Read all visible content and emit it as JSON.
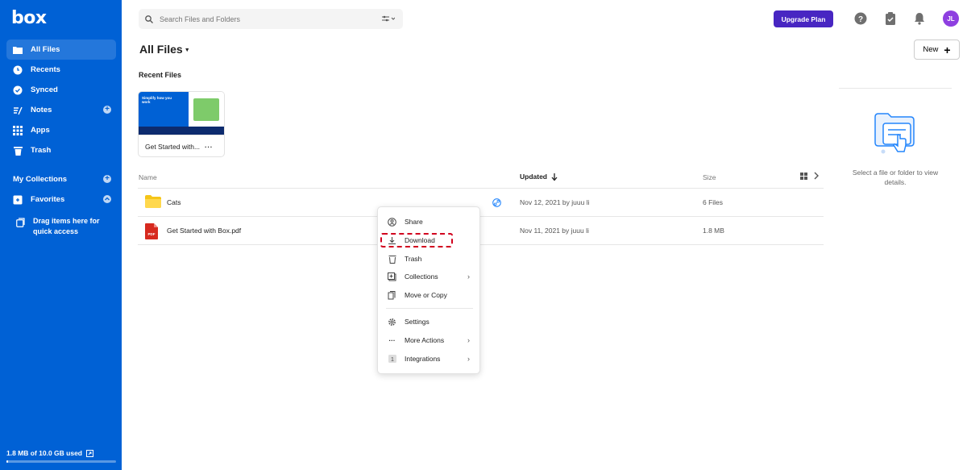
{
  "sidebar": {
    "logo": "box",
    "items": [
      {
        "label": "All Files",
        "icon": "folder-icon"
      },
      {
        "label": "Recents",
        "icon": "clock-icon"
      },
      {
        "label": "Synced",
        "icon": "check-circle-icon"
      },
      {
        "label": "Notes",
        "icon": "notes-icon"
      },
      {
        "label": "Apps",
        "icon": "apps-grid-icon"
      },
      {
        "label": "Trash",
        "icon": "trash-icon"
      },
      {
        "label": "My Collections",
        "icon": ""
      },
      {
        "label": "Favorites",
        "icon": "favorites-icon"
      }
    ],
    "drag_hint": "Drag items here for quick access",
    "storage": "1.8 MB of 10.0 GB used",
    "storage_fraction": 0.00018
  },
  "header": {
    "search_placeholder": "Search Files and Folders",
    "upgrade_label": "Upgrade Plan",
    "avatar_initials": "JL"
  },
  "main": {
    "title": "All Files",
    "new_label": "New",
    "recent_label": "Recent Files",
    "recent_cards": [
      {
        "name": "Get Started with...",
        "thumb_text": "Simplify how you work"
      }
    ],
    "columns": {
      "name": "Name",
      "updated": "Updated",
      "size": "Size"
    },
    "rows": [
      {
        "name": "Cats",
        "updated": "Nov 12, 2021 by juuu li",
        "size": "6 Files",
        "type": "folder"
      },
      {
        "name": "Get Started with Box.pdf",
        "updated": "Nov 11, 2021 by juuu li",
        "size": "1.8 MB",
        "type": "pdf"
      }
    ]
  },
  "context_menu": {
    "items": [
      {
        "label": "Share",
        "icon": "share-icon"
      },
      {
        "label": "Download",
        "icon": "download-icon"
      },
      {
        "label": "Trash",
        "icon": "trash-icon"
      },
      {
        "label": "Collections",
        "icon": "collections-icon"
      },
      {
        "label": "Move or Copy",
        "icon": "copy-icon"
      },
      {
        "label": "Settings",
        "icon": "gear-icon"
      },
      {
        "label": "More Actions",
        "icon": "more-icon"
      },
      {
        "label": "Integrations",
        "icon": "integrations-icon"
      }
    ]
  },
  "details_panel": {
    "empty_text": "Select a file or folder to view details."
  },
  "colors": {
    "sidebar": "#0061d5",
    "upgrade": "#4826c2",
    "avatar": "#8e3fe0",
    "highlight": "#d1001f"
  }
}
